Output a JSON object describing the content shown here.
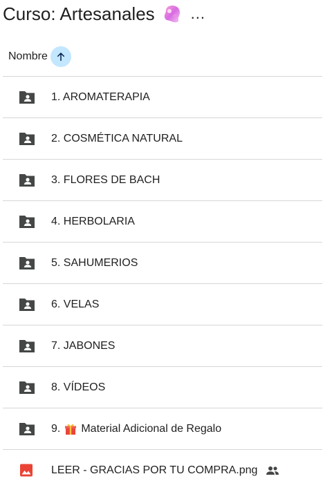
{
  "header": {
    "title": "Curso: Artesanales",
    "more": "..."
  },
  "sort": {
    "label": "Nombre"
  },
  "items": [
    {
      "prefix": "",
      "label": "1. AROMATERAPIA",
      "type": "shared-folder"
    },
    {
      "prefix": "",
      "label": "2. COSMÉTICA NATURAL",
      "type": "shared-folder"
    },
    {
      "prefix": "",
      "label": "3. FLORES DE BACH",
      "type": "shared-folder"
    },
    {
      "prefix": "",
      "label": "4. HERBOLARIA",
      "type": "shared-folder"
    },
    {
      "prefix": "",
      "label": "5. SAHUMERIOS",
      "type": "shared-folder"
    },
    {
      "prefix": "",
      "label": "6. VELAS",
      "type": "shared-folder"
    },
    {
      "prefix": "",
      "label": "7. JABONES",
      "type": "shared-folder"
    },
    {
      "prefix": "",
      "label": "8. VÍDEOS",
      "type": "shared-folder"
    },
    {
      "prefix": "9.",
      "label": "Material Adicional de Regalo",
      "type": "shared-folder"
    },
    {
      "prefix": "",
      "label": "LEER - GRACIAS POR TU COMPRA.png",
      "type": "image-file"
    }
  ],
  "colors": {
    "folder": "#444746",
    "image_file": "#ea4335",
    "sort_button_bg": "#c2e7ff",
    "arrow": "#041e49",
    "divider": "#d6d6d6"
  }
}
